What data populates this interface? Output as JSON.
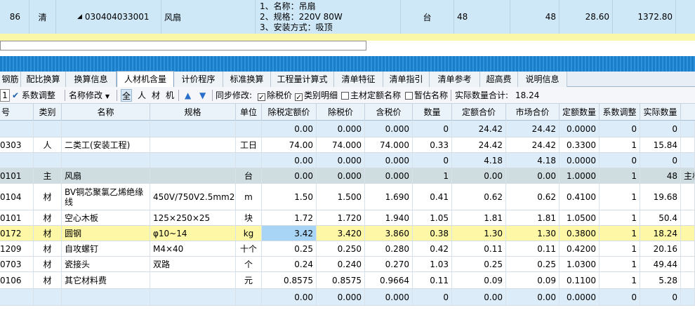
{
  "top_row": {
    "seq": "86",
    "type": "清",
    "code": "030404033001",
    "name": "风扇",
    "features": [
      "1、名称：吊扇",
      "2、规格：220V  80W",
      "3、安装方式：吸顶"
    ],
    "unit": "台",
    "qty1": "48",
    "qty2": "48",
    "price": "28.60",
    "total": "1372.80"
  },
  "tabs": [
    "钢筋",
    "配比换算",
    "换算信息",
    "人材机含量",
    "计价程序",
    "标准换算",
    "工程量计算式",
    "清单特征",
    "清单指引",
    "清单参考",
    "超高费",
    "说明信息"
  ],
  "active_tab": "人材机含量",
  "toolbar": {
    "spin_value": "1",
    "system_adjust": "系数调整",
    "name_modify": "名称修改",
    "filter_all": "全",
    "filter_labor": "人",
    "filter_material": "材",
    "filter_machine": "机",
    "sync_label": "同步修改:",
    "cb_tax_excluded": "除税价",
    "cb_category_detail": "类别明细",
    "cb_main_quota_name": "主材定额名称",
    "cb_temp_name": "暂估名称",
    "actual_qty_total_label": "实际数量合计:",
    "actual_qty_total": "18.24"
  },
  "columns": [
    "号",
    "类别",
    "名称",
    "规格",
    "单位",
    "除税定额价",
    "除税价",
    "含税价",
    "数量",
    "定额合价",
    "市场合价",
    "定额数量",
    "系数调整",
    "实际数量"
  ],
  "rows": [
    {
      "code": "",
      "cat": "",
      "name": "",
      "spec": "",
      "unit": "",
      "c1": "0.00",
      "c2": "0.000",
      "c3": "0.000",
      "qty": "0",
      "c5": "24.42",
      "c6": "24.42",
      "c7": "0.0000",
      "c8": "0",
      "c9": "0",
      "extra": ""
    },
    {
      "code": "0303",
      "cat": "人",
      "name": "二类工(安装工程)",
      "spec": "",
      "unit": "工日",
      "c1": "74.00",
      "c2": "74.000",
      "c3": "74.000",
      "qty": "0.33",
      "c5": "24.42",
      "c6": "24.42",
      "c7": "0.3300",
      "c8": "1",
      "c9": "15.84",
      "extra": ""
    },
    {
      "code": "",
      "cat": "",
      "name": "",
      "spec": "",
      "unit": "",
      "c1": "0.00",
      "c2": "0.000",
      "c3": "0.000",
      "qty": "0",
      "c5": "4.18",
      "c6": "4.18",
      "c7": "0.0000",
      "c8": "0",
      "c9": "0",
      "extra": ""
    },
    {
      "code": "0101",
      "cat": "主",
      "name": "风扇",
      "spec": "",
      "unit": "台",
      "c1": "0.00",
      "c2": "0.000",
      "c3": "0.000",
      "qty": "1",
      "c5": "0.00",
      "c6": "0.00",
      "c7": "1.0000",
      "c8": "1",
      "c9": "48",
      "extra": "主材"
    },
    {
      "code": "0104",
      "cat": "材",
      "name": "BV铜芯聚氯乙烯绝缘线",
      "spec": "450V/750V2.5mm2",
      "unit": "m",
      "c1": "1.50",
      "c2": "1.500",
      "c3": "1.690",
      "qty": "0.41",
      "c5": "0.62",
      "c6": "0.62",
      "c7": "0.4100",
      "c8": "1",
      "c9": "19.68",
      "extra": ""
    },
    {
      "code": "0101",
      "cat": "材",
      "name": "空心木板",
      "spec": "125×250×25",
      "unit": "块",
      "c1": "1.72",
      "c2": "1.720",
      "c3": "1.940",
      "qty": "1.05",
      "c5": "1.81",
      "c6": "1.81",
      "c7": "1.0500",
      "c8": "1",
      "c9": "50.4",
      "extra": ""
    },
    {
      "code": "0172",
      "cat": "材",
      "name": "圆钢",
      "spec": "φ10~14",
      "unit": "kg",
      "c1": "3.42",
      "c2": "3.420",
      "c3": "3.860",
      "qty": "0.38",
      "c5": "1.30",
      "c6": "1.30",
      "c7": "0.3800",
      "c8": "1",
      "c9": "18.24",
      "extra": ""
    },
    {
      "code": "1209",
      "cat": "材",
      "name": "自攻螺钉",
      "spec": "M4×40",
      "unit": "十个",
      "c1": "0.25",
      "c2": "0.250",
      "c3": "0.280",
      "qty": "0.42",
      "c5": "0.11",
      "c6": "0.11",
      "c7": "0.4200",
      "c8": "1",
      "c9": "20.16",
      "extra": ""
    },
    {
      "code": "0703",
      "cat": "材",
      "name": "瓷接头",
      "spec": "双路",
      "unit": "个",
      "c1": "0.24",
      "c2": "0.240",
      "c3": "0.270",
      "qty": "1.03",
      "c5": "0.25",
      "c6": "0.25",
      "c7": "1.0300",
      "c8": "1",
      "c9": "49.44",
      "extra": ""
    },
    {
      "code": "0106",
      "cat": "材",
      "name": "其它材料费",
      "spec": "",
      "unit": "元",
      "c1": "0.8575",
      "c2": "0.8575",
      "c3": "0.9664",
      "qty": "0.11",
      "c5": "0.09",
      "c6": "0.09",
      "c7": "0.1100",
      "c8": "1",
      "c9": "5.28",
      "extra": ""
    },
    {
      "code": "",
      "cat": "",
      "name": "",
      "spec": "",
      "unit": "",
      "c1": "0.00",
      "c2": "0.000",
      "c3": "0.000",
      "qty": "0",
      "c5": "0.00",
      "c6": "0.00",
      "c7": "0.0000",
      "c8": "0",
      "c9": "0",
      "extra": ""
    }
  ],
  "colors": {
    "group_row": "#dcecf8",
    "main_row": "#cfdde0",
    "selected_row": "#fdf7a6",
    "selected_cell": "#a8d4f5",
    "top_row": "#cfe8f8",
    "blue_bar": "#1a7ec9"
  }
}
